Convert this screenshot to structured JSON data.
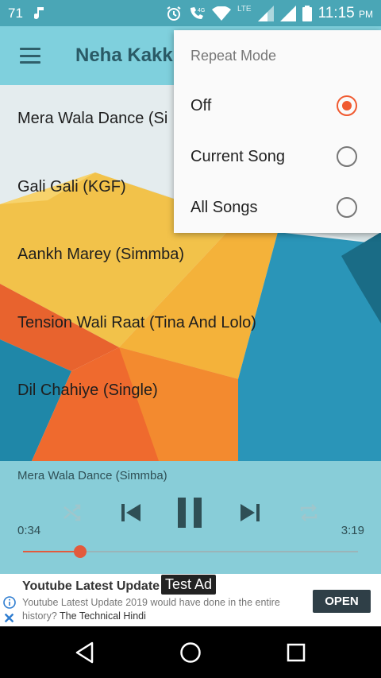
{
  "status_bar": {
    "notification_count": "71",
    "network": "LTE",
    "time": "11:15",
    "ampm": "PM",
    "icons": [
      "music-note-icon",
      "alarm-icon",
      "wifi-call-icon",
      "wifi-icon",
      "signal-icon",
      "battery-icon"
    ]
  },
  "app_bar": {
    "title": "Neha Kakk"
  },
  "songs": [
    "Mera Wala Dance (Si",
    "Gali Gali (KGF)",
    "Aankh Marey (Simmba)",
    "Tension Wali Raat (Tina And Lolo)",
    "Dil Chahiye (Single)"
  ],
  "player": {
    "now_playing": "Mera Wala Dance (Simmba)",
    "current_time": "0:34",
    "total_time": "3:19",
    "progress_fraction": 0.17,
    "accent_color": "#e35a3c"
  },
  "ad": {
    "title": "Youtube Latest Update 2",
    "tag": "Test Ad",
    "description": "Youtube Latest Update 2019 would have done in the entire history?",
    "advertiser": "The Technical Hindi",
    "button": "OPEN"
  },
  "popup": {
    "title": "Repeat Mode",
    "options": [
      "Off",
      "Current Song",
      "All Songs"
    ],
    "selected": "Off",
    "accent_color": "#f05a30"
  }
}
